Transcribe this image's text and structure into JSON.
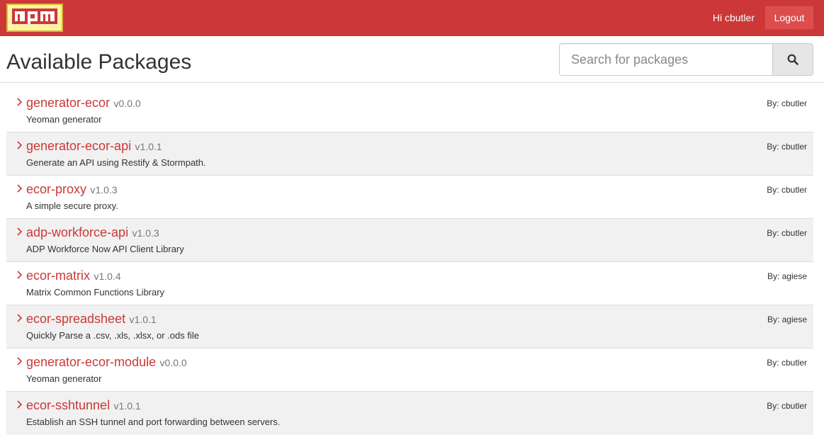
{
  "header": {
    "logo_text": "npm",
    "greeting": "Hi cbutler",
    "logout_label": "Logout"
  },
  "page": {
    "title": "Available Packages"
  },
  "search": {
    "placeholder": "Search for packages",
    "value": "",
    "button_icon": "search-icon"
  },
  "packages": [
    {
      "name": "generator-ecor",
      "version": "v0.0.0",
      "description": "Yeoman generator",
      "author": "By: cbutler"
    },
    {
      "name": "generator-ecor-api",
      "version": "v1.0.1",
      "description": "Generate an API using Restify & Stormpath.",
      "author": "By: cbutler"
    },
    {
      "name": "ecor-proxy",
      "version": "v1.0.3",
      "description": "A simple secure proxy.",
      "author": "By: cbutler"
    },
    {
      "name": "adp-workforce-api",
      "version": "v1.0.3",
      "description": "ADP Workforce Now API Client Library",
      "author": "By: cbutler"
    },
    {
      "name": "ecor-matrix",
      "version": "v1.0.4",
      "description": "Matrix Common Functions Library",
      "author": "By: agiese"
    },
    {
      "name": "ecor-spreadsheet",
      "version": "v1.0.1",
      "description": "Quickly Parse a .csv, .xls, .xlsx, or .ods file",
      "author": "By: agiese"
    },
    {
      "name": "generator-ecor-module",
      "version": "v0.0.0",
      "description": "Yeoman generator",
      "author": "By: cbutler"
    },
    {
      "name": "ecor-sshtunnel",
      "version": "v1.0.1",
      "description": "Establish an SSH tunnel and port forwarding between servers.",
      "author": "By: cbutler"
    }
  ],
  "colors": {
    "brand_red": "#cb3837",
    "logo_yellow": "#fef3a7",
    "row_alt": "#f1f1f1"
  }
}
